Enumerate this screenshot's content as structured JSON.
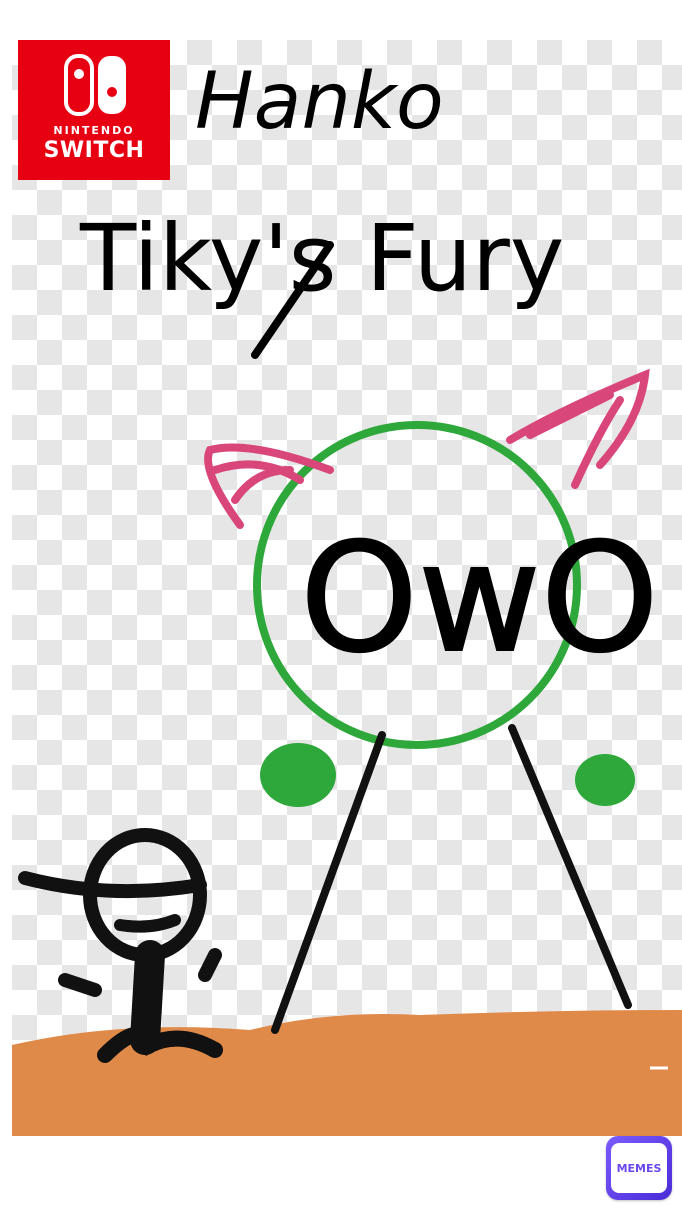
{
  "logo": {
    "brand": "NINTENDO",
    "model": "SWITCH"
  },
  "drawing": {
    "title_top": "Hanko",
    "title_main": "Tiky's Fury",
    "face_text": "OwO"
  },
  "watermark": {
    "label": "MEMES"
  },
  "colors": {
    "nintendo_red": "#e60012",
    "ground": "#e08a4a",
    "circle_green": "#2ea83a",
    "horn_pink": "#d9467a",
    "badge_purple": "#6a48f0"
  }
}
